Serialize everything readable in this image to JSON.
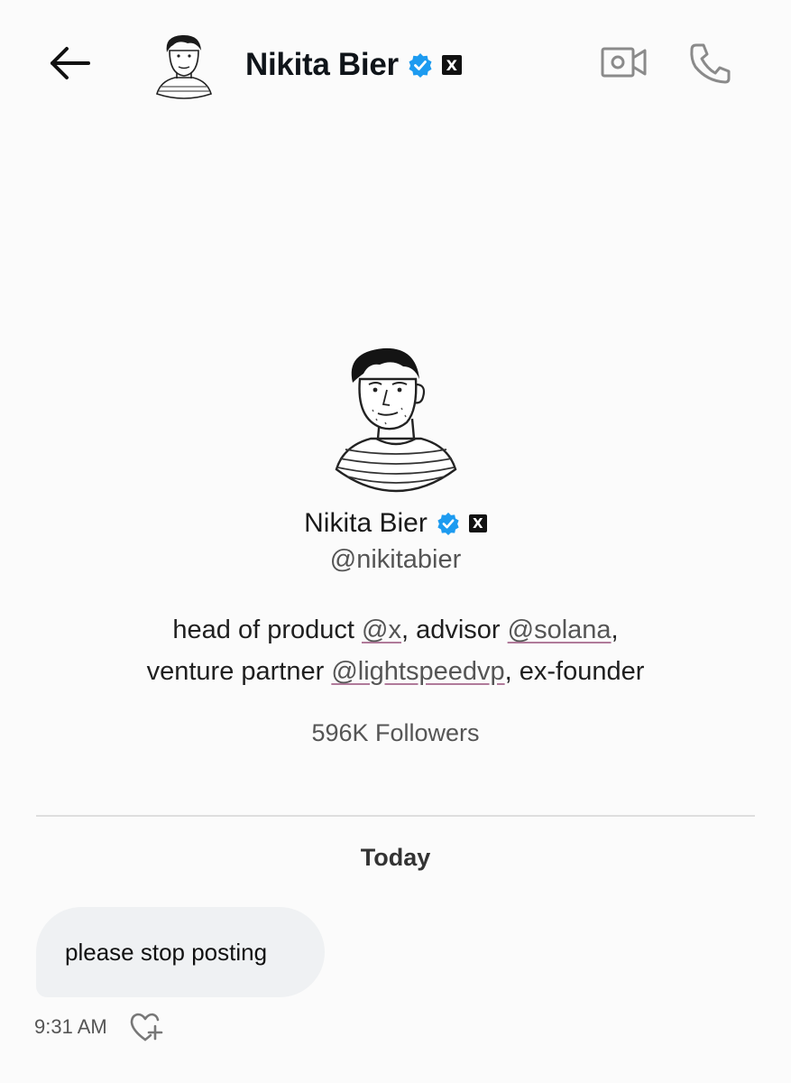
{
  "header": {
    "name": "Nikita Bier",
    "back_icon": "back-arrow-icon",
    "verified_icon": "verified-badge-icon",
    "affiliation_badge": "X",
    "video_icon": "video-call-icon",
    "call_icon": "phone-call-icon"
  },
  "profile": {
    "name": "Nikita Bier",
    "handle": "@nikitabier",
    "affiliation_badge": "X",
    "bio": {
      "line1_prefix": "head of product ",
      "mention1": "@x",
      "line1_middle": ", advisor ",
      "mention2": "@solana",
      "line1_suffix": ",",
      "line2_prefix": "venture partner ",
      "mention3": "@lightspeedvp",
      "line2_suffix": ", ex-founder"
    },
    "followers": "596K Followers"
  },
  "conversation": {
    "date_label": "Today",
    "messages": [
      {
        "text": "please stop posting",
        "time": "9:31 AM",
        "reaction_icon": "add-reaction-heart-icon"
      }
    ]
  },
  "colors": {
    "verified_blue": "#1d9bf0",
    "bubble_bg": "#eff1f3",
    "divider": "#dedede",
    "icon_gray": "#8a8a8a"
  }
}
